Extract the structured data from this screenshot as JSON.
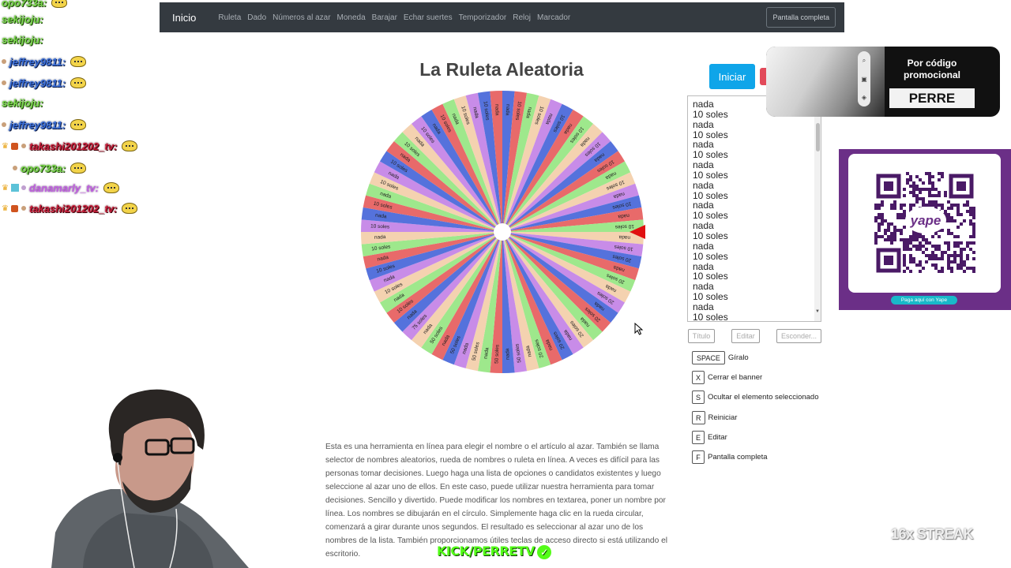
{
  "navbar": {
    "brand": "Inicio",
    "links": [
      "Ruleta",
      "Dado",
      "Números al azar",
      "Moneda",
      "Barajar",
      "Echar suertes",
      "Temporizador",
      "Reloj",
      "Marcador"
    ],
    "fullscreen_label": "Pantalla completa"
  },
  "chat": {
    "lines": [
      {
        "name": "opo733a:",
        "color": "green"
      },
      {
        "name": "sekijoju:",
        "color": "green"
      },
      {
        "name": "sekijoju:",
        "color": "green"
      },
      {
        "name": "jeffrey9811:",
        "color": "blue"
      },
      {
        "name": "jeffrey9811:",
        "color": "blue"
      },
      {
        "name": "sekijoju:",
        "color": "green"
      },
      {
        "name": "jeffrey9811:",
        "color": "blue"
      },
      {
        "name": "takashi201202_tv:",
        "color": "red"
      },
      {
        "name": "opo733a:",
        "color": "green"
      },
      {
        "name": "danamarly_tv:",
        "color": "magenta"
      },
      {
        "name": "takashi201202_tv:",
        "color": "red"
      }
    ]
  },
  "title": "La Ruleta Aleatoria",
  "wheel": {
    "segments": [
      "nada",
      "10 soles",
      "nada",
      "10 soles",
      "nada",
      "10 soles",
      "nada",
      "10 soles",
      "nada",
      "10 soles",
      "nada",
      "10 soles",
      "nada",
      "10 soles",
      "nada",
      "10 soles",
      "nada",
      "10 soles",
      "nada",
      "10 soles",
      "20 soles",
      "nada",
      "20 soles",
      "nada",
      "20 soles",
      "nada",
      "20 soles",
      "nada",
      "20 soles",
      "nada",
      "20 soles",
      "nada",
      "20 soles",
      "nada",
      "50 soles",
      "nada",
      "50 soles",
      "nada",
      "50 soles",
      "nada",
      "50 soles",
      "nada",
      "50 soles",
      "nada",
      "75 soles",
      "nada",
      "10 soles",
      "nada",
      "10 soles",
      "nada",
      "10 soles",
      "nada",
      "10 soles",
      "nada",
      "10 soles",
      "nada",
      "10 soles",
      "nada",
      "10 soles",
      "nada",
      "10 soles",
      "nada",
      "10 soles",
      "nada",
      "10 soles",
      "nada",
      "10 soles",
      "nada",
      "10 soles",
      "nada",
      "10 soles",
      "nada"
    ],
    "colors": [
      "#5572dc",
      "#e86a6a",
      "#9ee88c",
      "#f4d2b0",
      "#c88ce8"
    ]
  },
  "controls": {
    "start_label": "Iniciar",
    "names": [
      "nada",
      "10 soles",
      "nada",
      "10 soles",
      "nada",
      "10 soles",
      "nada",
      "10 soles",
      "nada",
      "10 soles",
      "nada",
      "10 soles",
      "nada",
      "10 soles",
      "nada",
      "10 soles",
      "nada",
      "10 soles",
      "nada",
      "10 soles",
      "nada",
      "10 soles"
    ],
    "title_btn": "Título",
    "edit_btn": "Editar",
    "hide_btn": "Esconder..."
  },
  "shortcuts": [
    {
      "key": "SPACE",
      "label": "Gíralo"
    },
    {
      "key": "X",
      "label": "Cerrar el banner"
    },
    {
      "key": "S",
      "label": "Ocultar el elemento seleccionado"
    },
    {
      "key": "R",
      "label": "Reiniciar"
    },
    {
      "key": "E",
      "label": "Editar"
    },
    {
      "key": "F",
      "label": "Pantalla completa"
    }
  ],
  "promo": {
    "text": "Por código promocional",
    "code": "PERRE"
  },
  "qr": {
    "brand": "yape",
    "caption": "Paga aquí con Yape"
  },
  "description": "Esta es una herramienta en línea para elegir el nombre o el artículo al azar. También se llama selector de nombres aleatorios, rueda de nombres o ruleta en línea. A veces es difícil para las personas tomar decisiones. Luego haga una lista de opciones o candidatos existentes y luego seleccione al azar uno de ellos. En este caso, puede utilizar nuestra herramienta para tomar decisiones. Sencillo y divertido. Puede modificar los nombres en textarea, poner un nombre por línea. Los nombres se dibujarán en el círculo. Simplemente haga clic en la rueda circular, comenzará a girar durante unos segundos. El resultado es seleccionar al azar uno de los nombres de la lista. También proporcionamos útiles teclas de acceso directo si está utilizando el escritorio.",
  "overlay": {
    "kick": "KICK/PERRETV",
    "streak": "16x STREAK"
  }
}
